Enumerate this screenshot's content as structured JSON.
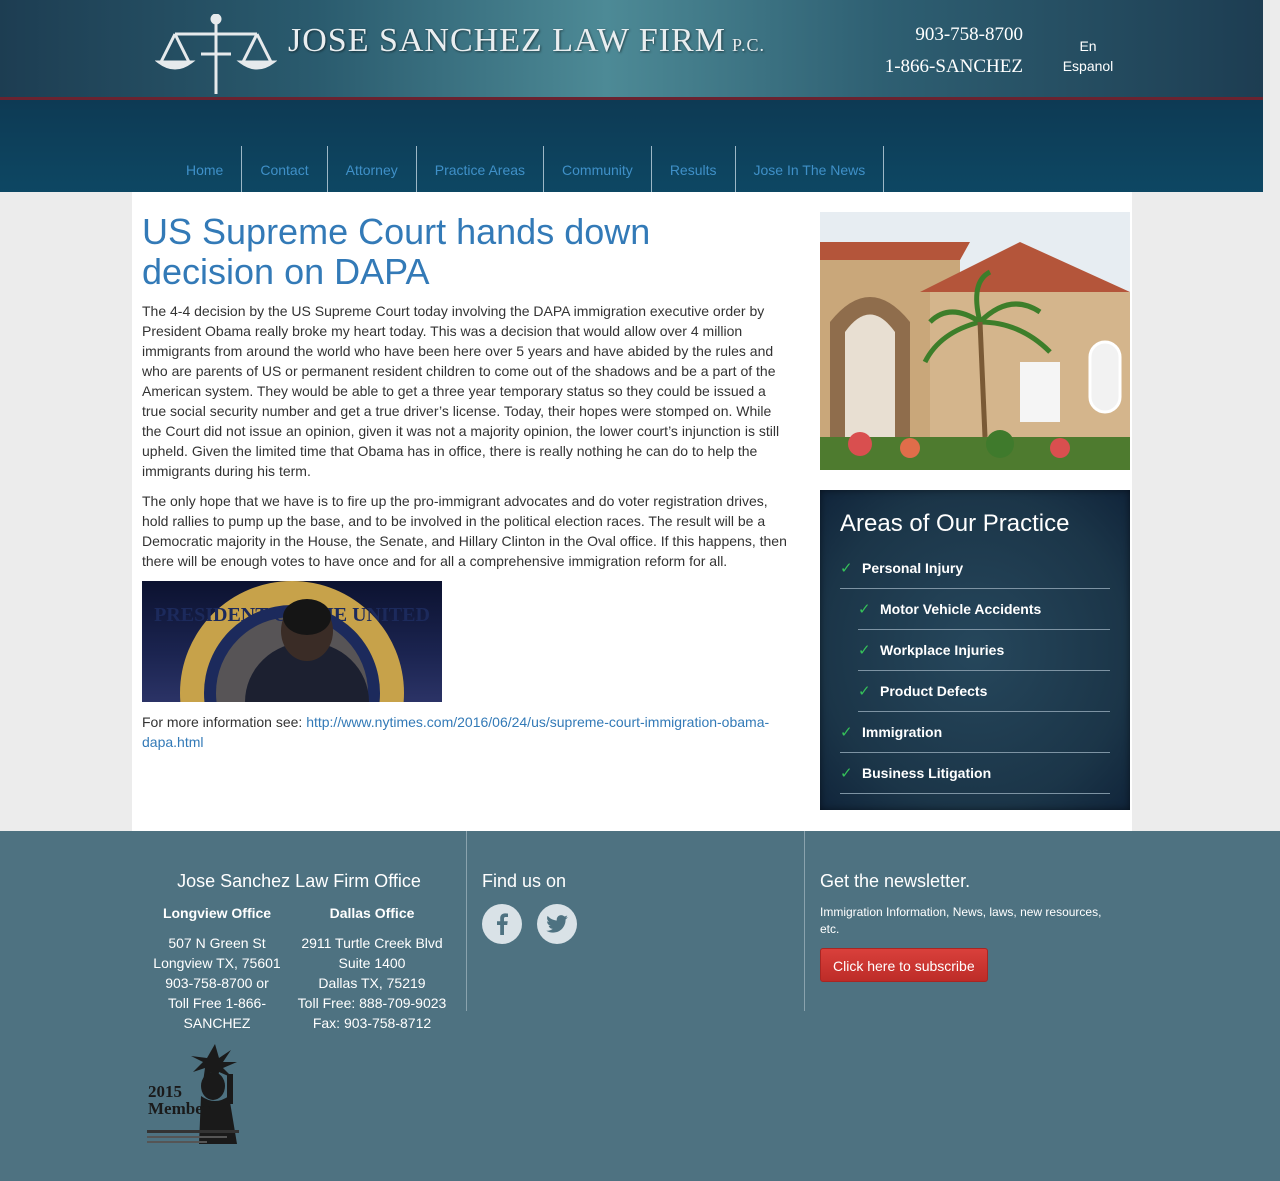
{
  "header": {
    "firm_name": "JOSE SANCHEZ LAW FIRM",
    "firm_suffix": "P.C.",
    "phone_primary": "903-758-8700",
    "phone_toll_free": "1-866-SANCHEZ",
    "lang_en": "En",
    "lang_es": "Espanol"
  },
  "nav": {
    "items": [
      "Home",
      "Contact",
      "Attorney",
      "Practice Areas",
      "Community",
      "Results",
      "Jose In The News"
    ]
  },
  "article": {
    "title": "US Supreme Court hands down decision on DAPA",
    "paragraph1": "The 4-4 decision by the US Supreme Court today involving the DAPA immigration executive order by President Obama really broke my heart today. This was a decision that would allow over 4 million immigrants from around the world who have been here over 5 years and have abided by the rules and who are parents of US or permanent resident children to come out of the shadows and be a part of the American system. They would be able to get a three year temporary status so they could be issued a true social security number and get a true driver’s license. Today, their hopes were stomped on. While the Court did not issue an opinion, given it was not a majority opinion, the lower court’s injunction is still upheld. Given the limited time that Obama has in office, there is really nothing he can do to help the immigrants during his term.",
    "paragraph2": "The only hope that we have is to fire up the pro-immigrant advocates and do voter registration drives, hold rallies to pump up the base, and to be involved in the political election races. The result will be a Democratic majority in the House, the Senate, and Hillary Clinton in the Oval office. If this happens, then there will be enough votes to have once and for all a comprehensive immigration reform for all.",
    "seal_text": "PRESIDENT OF THE UNITED",
    "more_info_label": "For more information see:",
    "more_info_link": "http://www.nytimes.com/2016/06/24/us/supreme-court-immigration-obama-dapa.html"
  },
  "sidebar": {
    "areas_title": "Areas of Our Practice",
    "areas": [
      {
        "label": "Personal Injury",
        "sub": false
      },
      {
        "label": "Motor Vehicle Accidents",
        "sub": true
      },
      {
        "label": "Workplace Injuries",
        "sub": true
      },
      {
        "label": "Product Defects",
        "sub": true
      },
      {
        "label": "Immigration",
        "sub": false
      },
      {
        "label": "Business Litigation",
        "sub": false
      }
    ]
  },
  "footer": {
    "office_title": "Jose Sanchez Law Firm Office",
    "longview": {
      "title": "Longview Office",
      "line1": "507 N Green St",
      "line2": "Longview TX, 75601",
      "line3": "903-758-8700 or",
      "line4": "Toll Free 1-866-SANCHEZ"
    },
    "dallas": {
      "title": "Dallas Office",
      "line1": "2911 Turtle Creek Blvd",
      "line2": "Suite 1400",
      "line3": "Dallas TX, 75219",
      "line4": "Toll Free: 888-709-9023",
      "line5": "Fax: 903-758-8712"
    },
    "find_us_title": "Find us on",
    "newsletter_title": "Get the newsletter.",
    "newsletter_text": "Immigration Information, News, laws, new resources, etc.",
    "subscribe_label": "Click here to subscribe",
    "member_year": "2015",
    "member_label": "Member"
  },
  "colors": {
    "link": "#337ab7",
    "footer_bg": "#4e7281",
    "check": "#35c159",
    "subscribe": "#c9302c"
  }
}
